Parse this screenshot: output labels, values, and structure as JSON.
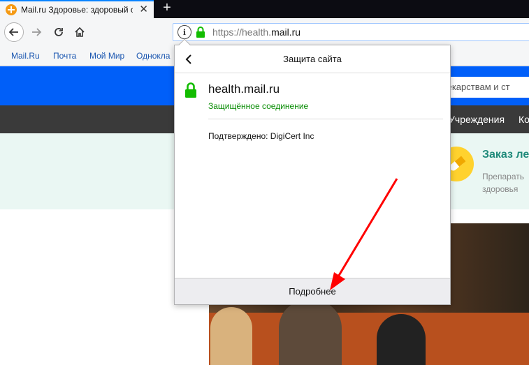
{
  "tab": {
    "title": "Mail.ru Здоровье: здоровый о",
    "close_glyph": "✕",
    "new_tab_glyph": "+"
  },
  "toolbar": {
    "url_prefix": "https://health.",
    "url_domain": "mail.ru"
  },
  "bookmarks": [
    "Mail.Ru",
    "Почта",
    "Мой Мир",
    "Однокла"
  ],
  "page": {
    "search_placeholder": "лекарствам и ст",
    "nav_items": [
      "Учреждения",
      "Ко"
    ],
    "promo_title": "Заказ ле",
    "promo_desc": "Препарать здоровья"
  },
  "popup": {
    "title": "Защита сайта",
    "host": "health.mail.ru",
    "secure_text": "Защищённое соединение",
    "verified_text": "Подтверждено: DigiCert Inc",
    "more_button": "Подробнее"
  },
  "colors": {
    "accent_blue": "#005ff9",
    "secure_green": "#058b00",
    "lock_green": "#12bc00",
    "annotation_red": "#ff0000"
  },
  "icons": {
    "back": "back-arrow-icon",
    "forward": "forward-arrow-icon",
    "reload": "reload-icon",
    "home": "home-icon",
    "info": "info-icon",
    "lock": "lock-icon"
  }
}
